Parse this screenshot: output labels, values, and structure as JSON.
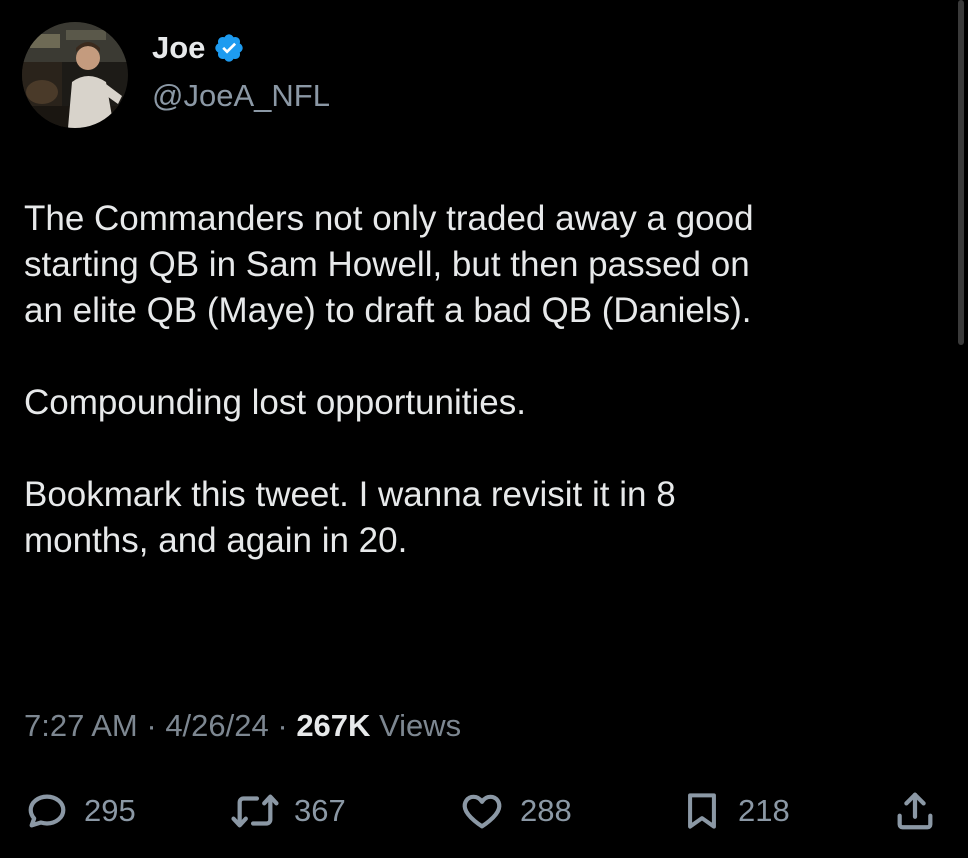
{
  "user": {
    "display_name": "Joe",
    "handle": "@JoeA_NFL",
    "avatar_icon": "profile-photo",
    "verified_icon": "verified-badge-icon"
  },
  "tweet": {
    "paragraphs": [
      "The Commanders not only traded away a good\nstarting QB in Sam Howell, but then passed on\nan elite QB (Maye) to draft a bad QB (Daniels).",
      "Compounding lost opportunities.",
      "Bookmark this tweet. I wanna revisit it in 8\nmonths, and again in 20."
    ],
    "time": "7:27 AM",
    "sep1": " · ",
    "date": "4/26/24",
    "sep2": " · ",
    "views_count": "267K",
    "views_label": " Views"
  },
  "actions": {
    "replies": "295",
    "reposts": "367",
    "likes": "288",
    "bookmarks": "218"
  },
  "colors": {
    "background": "#000000",
    "text": "#e7e9ea",
    "secondary": "#8b98a5",
    "verified": "#1d9bf0"
  }
}
